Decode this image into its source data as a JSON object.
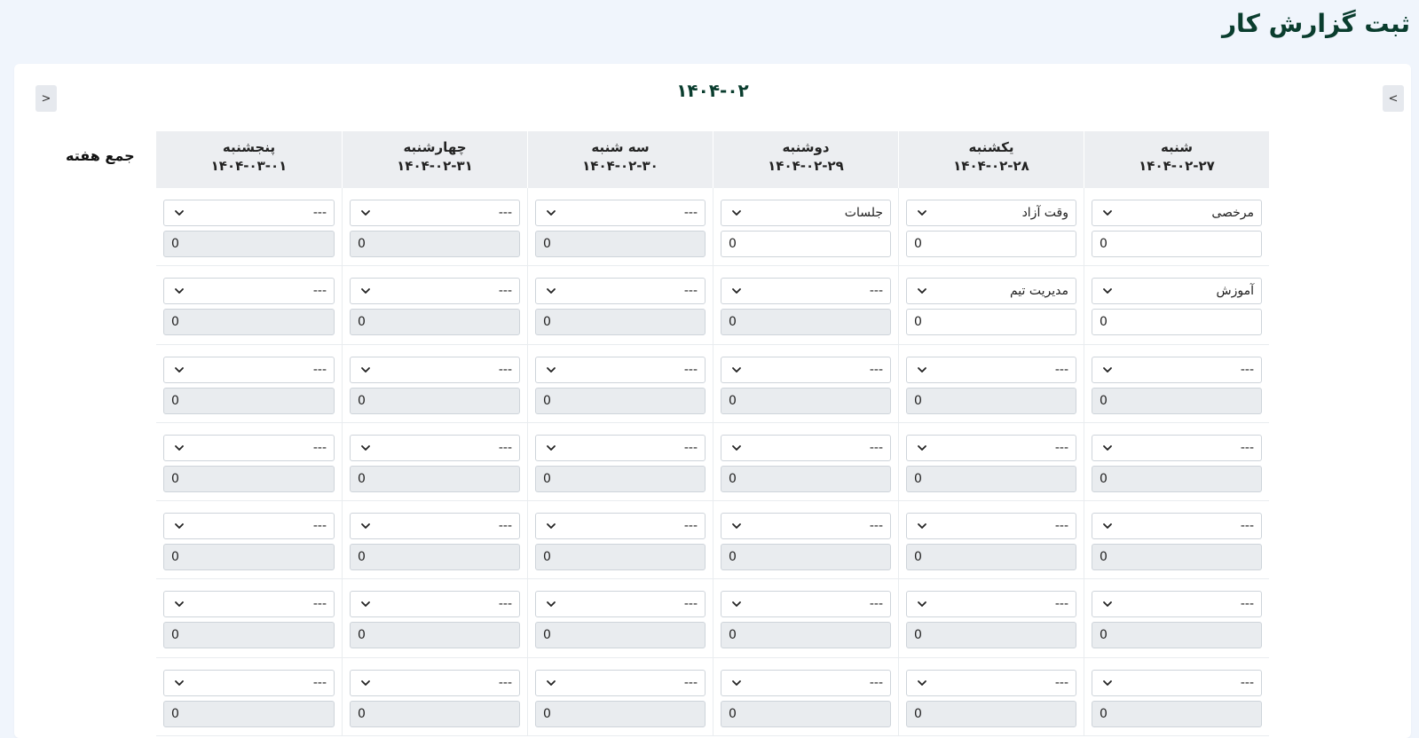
{
  "page": {
    "title": "ثبت گزارش کار"
  },
  "nav": {
    "prev_label": "<",
    "next_label": ">",
    "month": "۱۴۰۴-۰۲"
  },
  "week_total_label": "جمع هفته",
  "days": [
    {
      "name": "شنبه",
      "date": "۱۴۰۴-۰۲-۲۷"
    },
    {
      "name": "یکشنبه",
      "date": "۱۴۰۴-۰۲-۲۸"
    },
    {
      "name": "دوشنبه",
      "date": "۱۴۰۴-۰۲-۲۹"
    },
    {
      "name": "سه شنبه",
      "date": "۱۴۰۴-۰۲-۳۰"
    },
    {
      "name": "چهارشنبه",
      "date": "۱۴۰۴-۰۲-۳۱"
    },
    {
      "name": "پنجشنبه",
      "date": "۱۴۰۴-۰۳-۰۱"
    }
  ],
  "rows": [
    [
      {
        "task": "مرخصی",
        "hours": "0",
        "enabled": true
      },
      {
        "task": "وقت آزاد",
        "hours": "0",
        "enabled": true
      },
      {
        "task": "جلسات",
        "hours": "0",
        "enabled": true
      },
      {
        "task": "---",
        "hours": "0",
        "enabled": false
      },
      {
        "task": "---",
        "hours": "0",
        "enabled": false
      },
      {
        "task": "---",
        "hours": "0",
        "enabled": false
      }
    ],
    [
      {
        "task": "آموزش",
        "hours": "0",
        "enabled": true
      },
      {
        "task": "مدیریت تیم",
        "hours": "0",
        "enabled": true
      },
      {
        "task": "---",
        "hours": "0",
        "enabled": false
      },
      {
        "task": "---",
        "hours": "0",
        "enabled": false
      },
      {
        "task": "---",
        "hours": "0",
        "enabled": false
      },
      {
        "task": "---",
        "hours": "0",
        "enabled": false
      }
    ],
    [
      {
        "task": "---",
        "hours": "0",
        "enabled": false
      },
      {
        "task": "---",
        "hours": "0",
        "enabled": false
      },
      {
        "task": "---",
        "hours": "0",
        "enabled": false
      },
      {
        "task": "---",
        "hours": "0",
        "enabled": false
      },
      {
        "task": "---",
        "hours": "0",
        "enabled": false
      },
      {
        "task": "---",
        "hours": "0",
        "enabled": false
      }
    ],
    [
      {
        "task": "---",
        "hours": "0",
        "enabled": false
      },
      {
        "task": "---",
        "hours": "0",
        "enabled": false
      },
      {
        "task": "---",
        "hours": "0",
        "enabled": false
      },
      {
        "task": "---",
        "hours": "0",
        "enabled": false
      },
      {
        "task": "---",
        "hours": "0",
        "enabled": false
      },
      {
        "task": "---",
        "hours": "0",
        "enabled": false
      }
    ],
    [
      {
        "task": "---",
        "hours": "0",
        "enabled": false
      },
      {
        "task": "---",
        "hours": "0",
        "enabled": false
      },
      {
        "task": "---",
        "hours": "0",
        "enabled": false
      },
      {
        "task": "---",
        "hours": "0",
        "enabled": false
      },
      {
        "task": "---",
        "hours": "0",
        "enabled": false
      },
      {
        "task": "---",
        "hours": "0",
        "enabled": false
      }
    ],
    [
      {
        "task": "---",
        "hours": "0",
        "enabled": false
      },
      {
        "task": "---",
        "hours": "0",
        "enabled": false
      },
      {
        "task": "---",
        "hours": "0",
        "enabled": false
      },
      {
        "task": "---",
        "hours": "0",
        "enabled": false
      },
      {
        "task": "---",
        "hours": "0",
        "enabled": false
      },
      {
        "task": "---",
        "hours": "0",
        "enabled": false
      }
    ],
    [
      {
        "task": "---",
        "hours": "0",
        "enabled": false
      },
      {
        "task": "---",
        "hours": "0",
        "enabled": false
      },
      {
        "task": "---",
        "hours": "0",
        "enabled": false
      },
      {
        "task": "---",
        "hours": "0",
        "enabled": false
      },
      {
        "task": "---",
        "hours": "0",
        "enabled": false
      },
      {
        "task": "---",
        "hours": "0",
        "enabled": false
      }
    ]
  ]
}
